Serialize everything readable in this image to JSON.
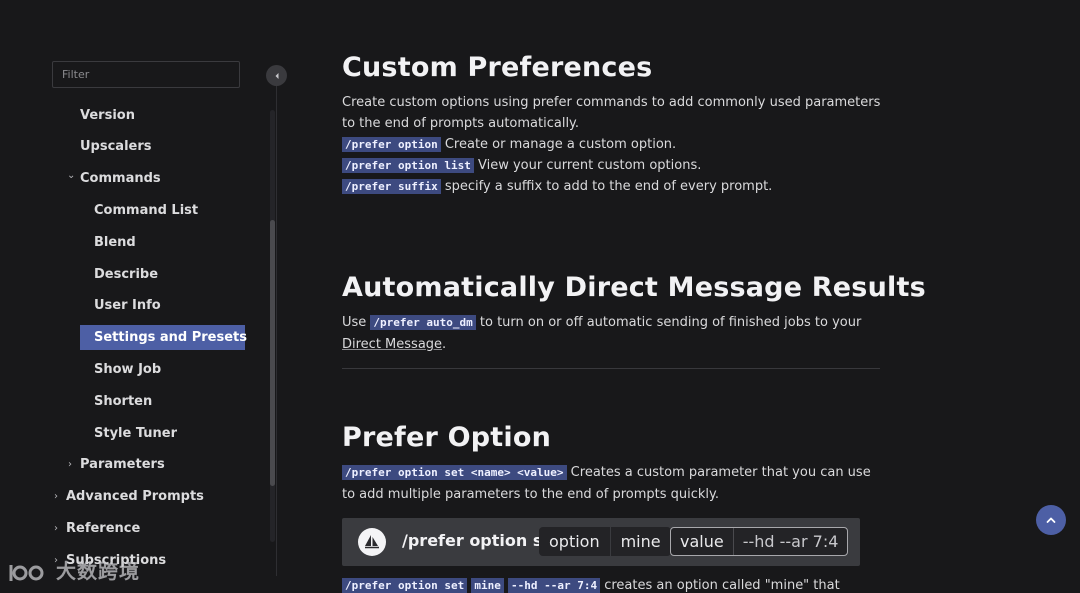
{
  "sidebar": {
    "filter_placeholder": "Filter",
    "items": [
      {
        "label": "Version"
      },
      {
        "label": "Upscalers"
      },
      {
        "label": "Commands",
        "chevron": "⌄"
      },
      {
        "label": "Command List"
      },
      {
        "label": "Blend"
      },
      {
        "label": "Describe"
      },
      {
        "label": "User Info"
      },
      {
        "label": "Settings and Presets",
        "active": true
      },
      {
        "label": "Show Job"
      },
      {
        "label": "Shorten"
      },
      {
        "label": "Style Tuner"
      },
      {
        "label": "Parameters",
        "chevron": "›"
      },
      {
        "label": "Advanced Prompts",
        "chevron": "›"
      },
      {
        "label": "Reference",
        "chevron": "›"
      },
      {
        "label": "Subscriptions",
        "chevron": "›"
      }
    ]
  },
  "sections": {
    "custom": {
      "title": "Custom Preferences",
      "line1": "Create custom options using prefer commands to add commonly used parameters",
      "line2": "to the end of prompts automatically.",
      "items": [
        {
          "code": "/prefer option",
          "text": " Create or manage a custom option."
        },
        {
          "code": "/prefer option list",
          "text": " View your current custom options."
        },
        {
          "code": "/prefer suffix",
          "text": " specify a suffix to add to the end of every prompt."
        }
      ]
    },
    "auto_dm": {
      "title": "Automatically Direct Message Results",
      "pre": "Use ",
      "code": "/prefer auto_dm",
      "post": " to turn on or off automatic sending of finished jobs to your",
      "link": "Direct Message",
      "end": "."
    },
    "prefer_option": {
      "title": "Prefer Option",
      "code": "/prefer option set <name> <value>",
      "text1": " Creates a custom parameter that you can use",
      "text2": "to add multiple parameters to the end of prompts quickly.",
      "demo": {
        "cmd": "/prefer option set",
        "opt_label": "option",
        "opt_value": "mine",
        "val_label": "value",
        "val_value": "--hd --ar 7:4"
      },
      "bottom": {
        "code1": "/prefer option set",
        "code2": "mine",
        "code3": "--hd --ar 7:4",
        "text": " creates an option called \"mine\" that"
      }
    }
  },
  "watermark": "大数跨境",
  "icons": {
    "collapse": "chevron-left-icon",
    "top": "arrow-up-icon"
  }
}
